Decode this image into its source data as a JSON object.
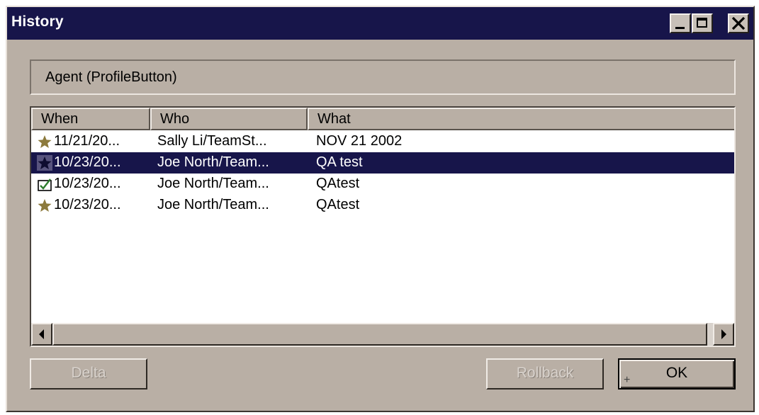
{
  "window": {
    "title": "History",
    "controls": {
      "minimize_icon": "minimize-icon",
      "maximize_icon": "maximize-icon",
      "close_icon": "close-icon"
    }
  },
  "object_label": "Agent (ProfileButton)",
  "list": {
    "columns": [
      "When",
      "Who",
      "What"
    ],
    "rows": [
      {
        "icon": "star-icon",
        "when": "11/21/20...",
        "who": "Sally Li/TeamSt...",
        "what": "NOV 21 2002",
        "selected": false
      },
      {
        "icon": "star-icon",
        "when": "10/23/20...",
        "who": "Joe North/Team...",
        "what": "QA test",
        "selected": true
      },
      {
        "icon": "checked-document-icon",
        "when": "10/23/20...",
        "who": "Joe North/Team...",
        "what": "QAtest",
        "selected": false
      },
      {
        "icon": "star-icon",
        "when": "10/23/20...",
        "who": "Joe North/Team...",
        "what": "QAtest",
        "selected": false
      }
    ]
  },
  "buttons": {
    "delta": "Delta",
    "rollback": "Rollback",
    "ok": "OK"
  },
  "colors": {
    "title_bar": "#17154a",
    "face": "#b9afa5",
    "selection": "#17154a",
    "star": "#8c7a3c"
  }
}
